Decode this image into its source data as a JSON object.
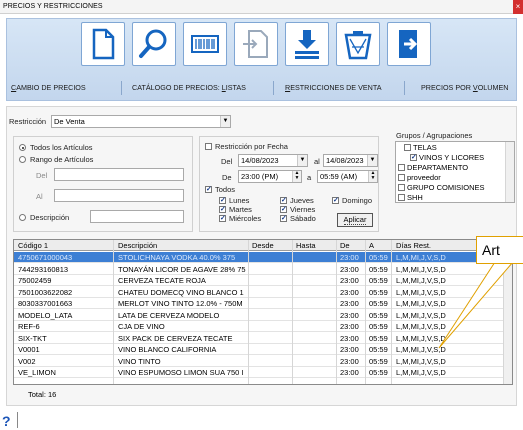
{
  "window": {
    "title": "PRECIOS Y RESTRICCIONES",
    "close_glyph": "×"
  },
  "toolbar": {
    "icons": [
      "new-document-icon",
      "search-icon",
      "barcode-icon",
      "transfer-icon",
      "download-icon",
      "recycle-bin-icon",
      "exit-icon"
    ],
    "tabs": [
      {
        "underline": "C",
        "rest": "AMBIO DE PRECIOS"
      },
      {
        "underline": "",
        "rest": "CATÁLOGO DE PRECIOS: ",
        "underline2": "L",
        "rest2": "ISTAS"
      },
      {
        "underline": "R",
        "rest": "ESTRICCIONES DE VENTA"
      },
      {
        "underline": "",
        "rest": "PRECIOS POR ",
        "underline2": "V",
        "rest2": "OLUMEN"
      }
    ]
  },
  "filters": {
    "restriccion_label": "Restricción",
    "restriccion_value": "De Venta",
    "todos_articulos": "Todos los Artículos",
    "rango_articulos": "Rango de Artículos",
    "del_label": "Del",
    "al_label": "Al",
    "descripcion_label": "Descripción",
    "restriccion_fecha": "Restricción por Fecha",
    "fecha_del_label": "Del",
    "fecha_del": "14/08/2023",
    "fecha_al_label": "al",
    "fecha_al": "14/08/2023",
    "hora_de_label": "De",
    "hora_de": "23:00 (PM)",
    "hora_a_label": "a",
    "hora_a": "05:59 (AM)",
    "todos_label": "Todos",
    "days": [
      "Lunes",
      "Martes",
      "Miércoles",
      "Jueves",
      "Viernes",
      "Sábado",
      "Domingo"
    ],
    "aplicar": "Aplicar"
  },
  "groups": {
    "title": "Grupos / Agrupaciones",
    "items": [
      {
        "label": "TELAS",
        "checked": false,
        "indent": 1
      },
      {
        "label": "VINOS Y LICORES",
        "checked": true,
        "indent": 1
      },
      {
        "label": "DEPARTAMENTO",
        "checked": false,
        "indent": 0
      },
      {
        "label": "proveedor",
        "checked": false,
        "indent": 0
      },
      {
        "label": "GRUPO COMISIONES",
        "checked": false,
        "indent": 0
      },
      {
        "label": "SHH",
        "checked": false,
        "indent": 0
      }
    ]
  },
  "grid": {
    "columns": [
      "Código 1",
      "Descripción",
      "Desde",
      "Hasta",
      "De",
      "A",
      "Días Rest."
    ],
    "rows": [
      [
        "4750671000043",
        "STOLICHNAYA VODKA 40.0% 375",
        "",
        "",
        "23:00",
        "05:59",
        "L,M,MI,J,V,S,D"
      ],
      [
        "744293160813",
        "TONAYÁN LICOR DE AGAVE 28% 75",
        "",
        "",
        "23:00",
        "05:59",
        "L,M,MI,J,V,S,D"
      ],
      [
        "75002459",
        "CERVEZA TECATE ROJA",
        "",
        "",
        "23:00",
        "05:59",
        "L,M,MI,J,V,S,D"
      ],
      [
        "7501003622082",
        "CHATEU DOMECQ VINO BLANCO 1",
        "",
        "",
        "23:00",
        "05:59",
        "L,M,MI,J,V,S,D"
      ],
      [
        "8030337001663",
        "MERLOT VINO TINTO 12.0% - 750M",
        "",
        "",
        "23:00",
        "05:59",
        "L,M,MI,J,V,S,D"
      ],
      [
        "MODELO_LATA",
        "LATA DE CERVEZA MODELO",
        "",
        "",
        "23:00",
        "05:59",
        "L,M,MI,J,V,S,D"
      ],
      [
        "REF-6",
        "CJA DE VINO",
        "",
        "",
        "23:00",
        "05:59",
        "L,M,MI,J,V,S,D"
      ],
      [
        "SIX-TKT",
        "SIX PACK DE CERVEZA TECATE",
        "",
        "",
        "23:00",
        "05:59",
        "L,M,MI,J,V,S,D"
      ],
      [
        "V0001",
        "VINO BLANCO CALIFORNIA",
        "",
        "",
        "23:00",
        "05:59",
        "L,M,MI,J,V,S,D"
      ],
      [
        "V002",
        "VINO TINTO",
        "",
        "",
        "23:00",
        "05:59",
        "L,M,MI,J,V,S,D"
      ],
      [
        "VE_LIMON",
        "VINO ESPUMOSO LIMON SUA 750 I",
        "",
        "",
        "23:00",
        "05:59",
        "L,M,MI,J,V,S,D"
      ]
    ],
    "total": "Total: 16"
  },
  "tooltip": "Art",
  "help_glyph": "?",
  "colors": {
    "selected_row": "#3d7fd4",
    "toolbar_bg": "#c9dbef",
    "icon_blue": "#1565c0",
    "tooltip_border": "#e0a000"
  }
}
